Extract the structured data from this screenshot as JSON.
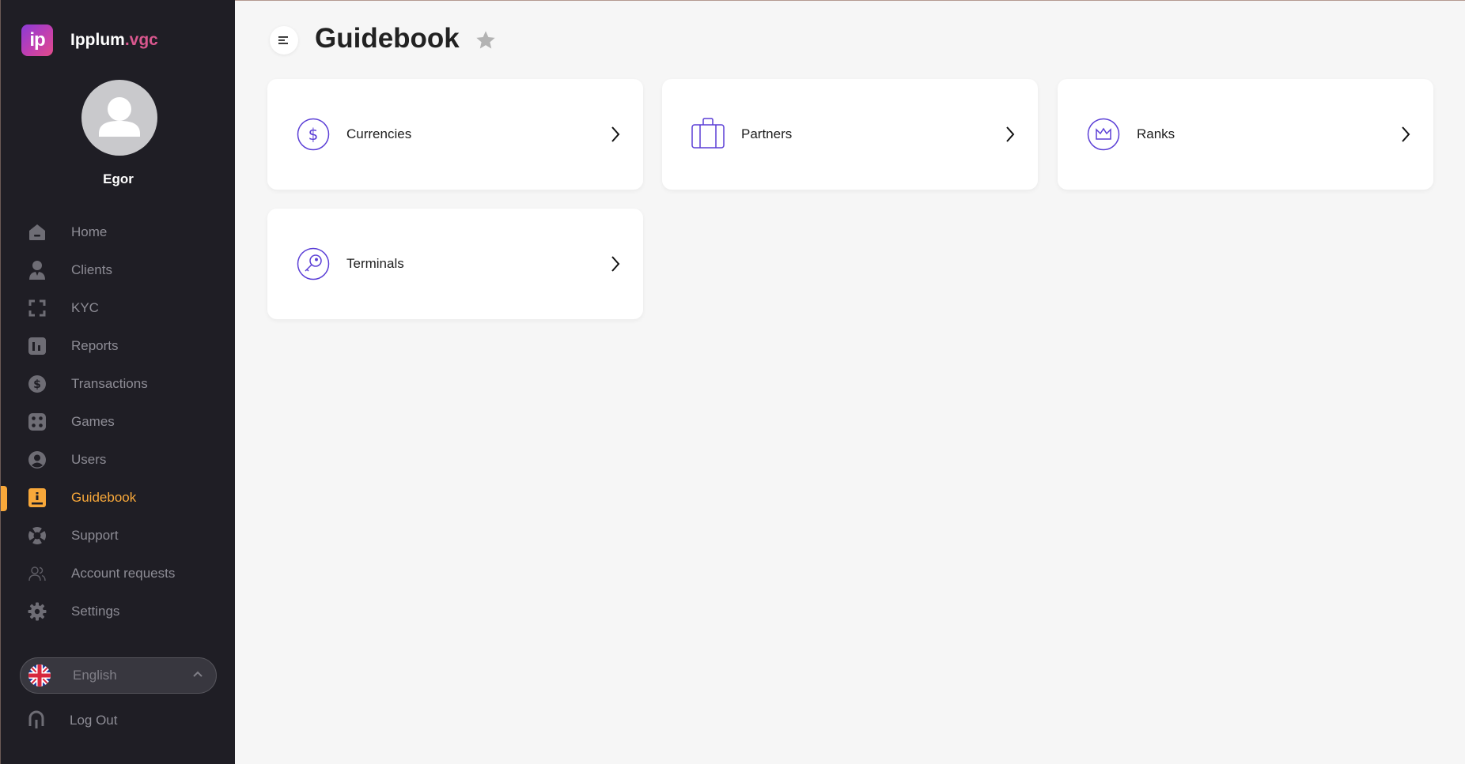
{
  "brand": {
    "logo_text": "ip",
    "name_main": "Ipplum",
    "name_ext": ".vgc"
  },
  "user": {
    "name": "Egor"
  },
  "nav": [
    {
      "label": "Home",
      "icon": "home-icon"
    },
    {
      "label": "Clients",
      "icon": "clients-icon"
    },
    {
      "label": "KYC",
      "icon": "scan-icon"
    },
    {
      "label": "Reports",
      "icon": "reports-icon"
    },
    {
      "label": "Transactions",
      "icon": "dollar-icon"
    },
    {
      "label": "Games",
      "icon": "games-icon"
    },
    {
      "label": "Users",
      "icon": "user-circle-icon"
    },
    {
      "label": "Guidebook",
      "icon": "book-icon",
      "active": true
    },
    {
      "label": "Support",
      "icon": "lifebuoy-icon"
    },
    {
      "label": "Account requests",
      "icon": "users-outline-icon"
    },
    {
      "label": "Settings",
      "icon": "gear-icon"
    }
  ],
  "language": {
    "label": "English",
    "flag": "uk-flag-icon"
  },
  "logout": {
    "label": "Log Out"
  },
  "page": {
    "title": "Guidebook"
  },
  "cards": [
    {
      "label": "Currencies",
      "icon": "dollar-circle-icon"
    },
    {
      "label": "Partners",
      "icon": "briefcase-icon"
    },
    {
      "label": "Ranks",
      "icon": "crown-icon"
    },
    {
      "label": "Terminals",
      "icon": "key-icon"
    }
  ],
  "colors": {
    "sidebar_bg": "#1f1e25",
    "accent": "#f8a83a",
    "icon_purple": "#5b3fd6",
    "content_bg": "#f6f6f6"
  }
}
